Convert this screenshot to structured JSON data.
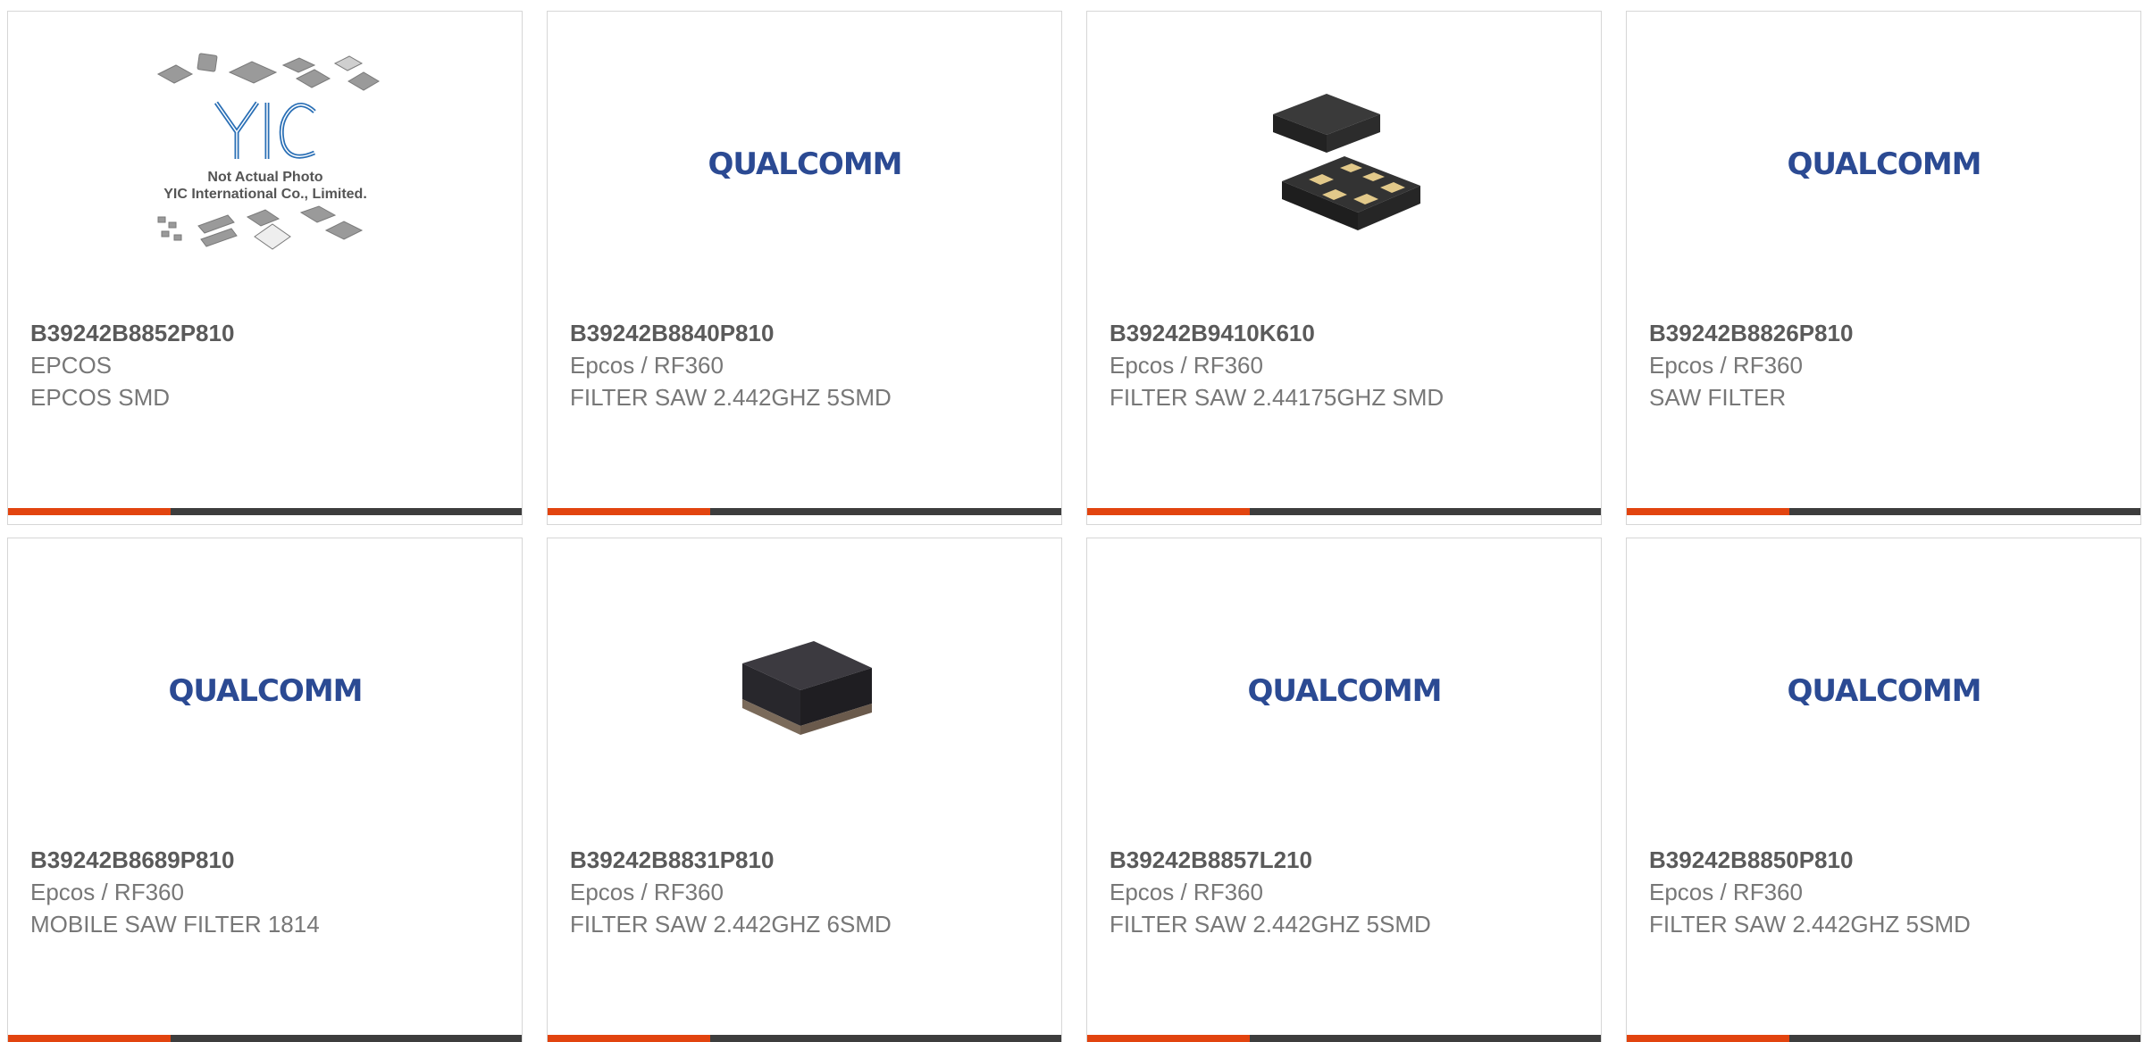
{
  "products": [
    {
      "part": "B39242B8852P810",
      "manufacturer": "EPCOS",
      "description": "EPCOS SMD",
      "image": "yic-placeholder",
      "placeholder": {
        "line1": "Not Actual Photo",
        "line2": "YIC International Co., Limited.",
        "logo": "YIC"
      }
    },
    {
      "part": "B39242B8840P810",
      "manufacturer": "Epcos / RF360",
      "description": "FILTER SAW 2.442GHZ 5SMD",
      "image": "qualcomm-logo"
    },
    {
      "part": "B39242B9410K610",
      "manufacturer": "Epcos / RF360",
      "description": "FILTER SAW 2.44175GHZ SMD",
      "image": "smd-package-pads"
    },
    {
      "part": "B39242B8826P810",
      "manufacturer": "Epcos / RF360",
      "description": "SAW FILTER",
      "image": "qualcomm-logo"
    },
    {
      "part": "B39242B8689P810",
      "manufacturer": "Epcos / RF360",
      "description": "MOBILE SAW FILTER 1814",
      "image": "qualcomm-logo"
    },
    {
      "part": "B39242B8831P810",
      "manufacturer": "Epcos / RF360",
      "description": "FILTER SAW 2.442GHZ 6SMD",
      "image": "smd-package-block"
    },
    {
      "part": "B39242B8857L210",
      "manufacturer": "Epcos / RF360",
      "description": "FILTER SAW 2.442GHZ 5SMD",
      "image": "qualcomm-logo"
    },
    {
      "part": "B39242B8850P810",
      "manufacturer": "Epcos / RF360",
      "description": "FILTER SAW 2.442GHZ 5SMD",
      "image": "qualcomm-logo"
    }
  ],
  "logo_text": {
    "qualcomm": "QUALCOMM"
  },
  "colors": {
    "accent": "#e2440f",
    "bar": "#3d3d3d",
    "qualcomm_blue": "#2b4a93",
    "yic_blue": "#2a6fb5"
  }
}
